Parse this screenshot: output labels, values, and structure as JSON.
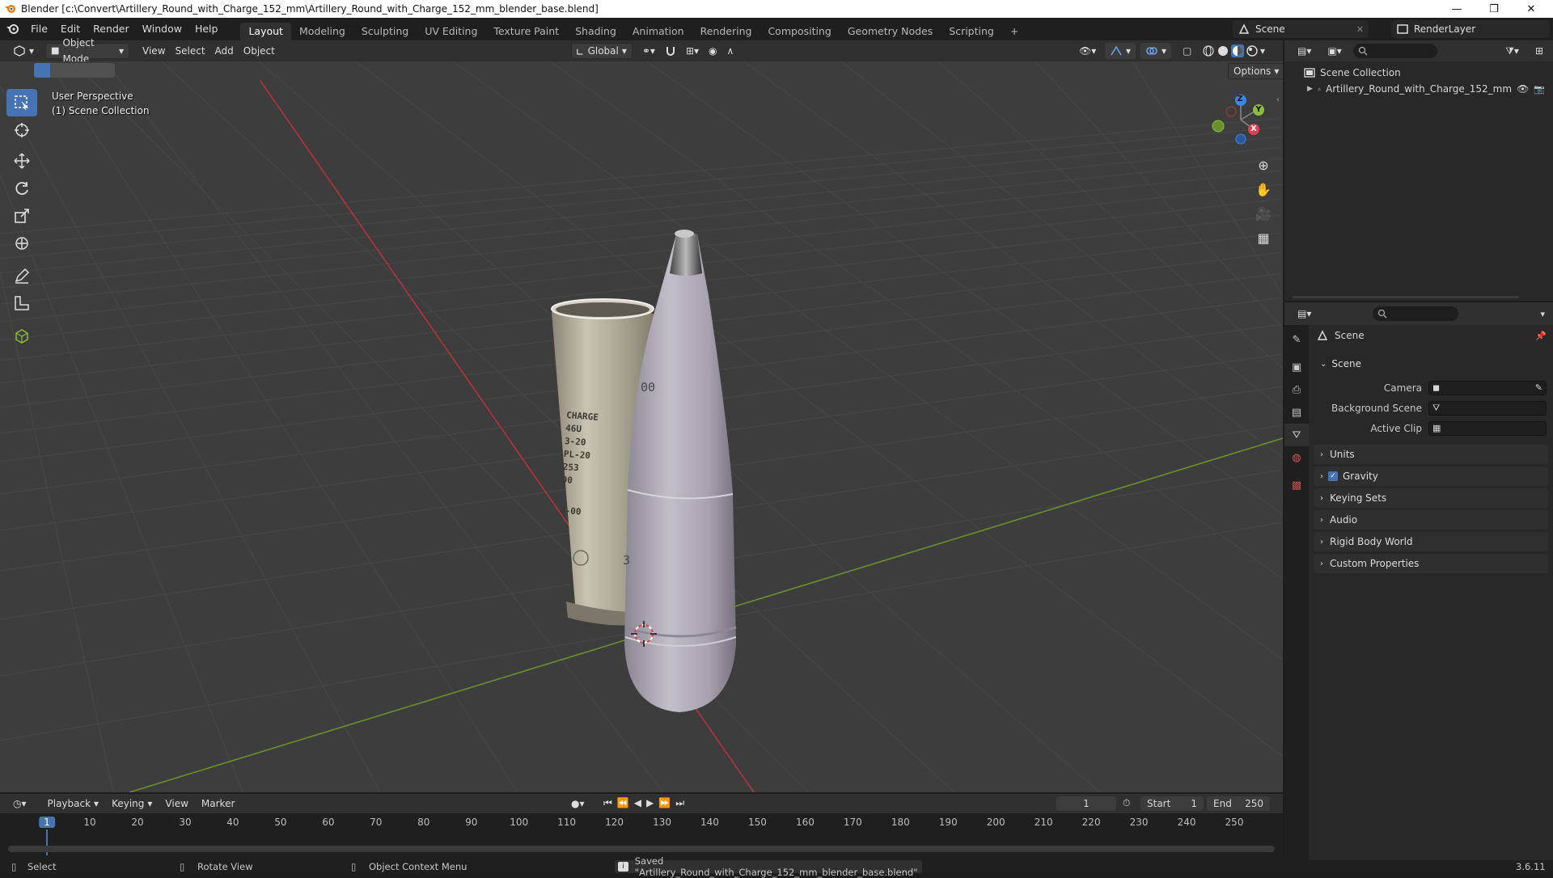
{
  "window": {
    "title": "Blender [c:\\Convert\\Artillery_Round_with_Charge_152_mm\\Artillery_Round_with_Charge_152_mm_blender_base.blend]",
    "minimize": "—",
    "maximize": "❐",
    "close": "✕"
  },
  "menu": [
    "File",
    "Edit",
    "Render",
    "Window",
    "Help"
  ],
  "workspaces": [
    "Layout",
    "Modeling",
    "Sculpting",
    "UV Editing",
    "Texture Paint",
    "Shading",
    "Animation",
    "Rendering",
    "Compositing",
    "Geometry Nodes",
    "Scripting"
  ],
  "workspace_add": "+",
  "scene_selector": {
    "scene": "Scene",
    "view_layer": "RenderLayer"
  },
  "viewport_header": {
    "mode": "Object Mode",
    "menus": [
      "View",
      "Select",
      "Add",
      "Object"
    ],
    "transform_orientation": "Global",
    "options": "Options"
  },
  "viewport": {
    "perspective": "User Perspective",
    "collection": "(1) Scene Collection",
    "axes": {
      "x": "X",
      "y": "Y",
      "z": "Z"
    },
    "casing_text": [
      "CHARGE",
      "46U",
      "3-20",
      "PL-20",
      "253",
      "00",
      "4-00"
    ],
    "shell_text": [
      "00",
      "3"
    ]
  },
  "outliner": {
    "root": "Scene Collection",
    "items": [
      {
        "label": "Artillery_Round_with_Charge_152_mm"
      }
    ]
  },
  "properties": {
    "context": "Scene",
    "panel": "Scene",
    "fields": {
      "camera": "Camera",
      "background_scene": "Background Scene",
      "active_clip": "Active Clip"
    },
    "sections": [
      "Units",
      "Gravity",
      "Keying Sets",
      "Audio",
      "Rigid Body World",
      "Custom Properties"
    ],
    "gravity_checked": true
  },
  "timeline": {
    "menus": [
      "Playback",
      "Keying",
      "View",
      "Marker"
    ],
    "current_frame": "1",
    "start_label": "Start",
    "start": "1",
    "end_label": "End",
    "end": "250",
    "ticks": [
      "1",
      "10",
      "20",
      "30",
      "40",
      "50",
      "60",
      "70",
      "80",
      "90",
      "100",
      "110",
      "120",
      "130",
      "140",
      "150",
      "160",
      "170",
      "180",
      "190",
      "200",
      "210",
      "220",
      "230",
      "240",
      "250"
    ]
  },
  "statusbar": {
    "select": "Select",
    "rotate": "Rotate View",
    "context_menu": "Object Context Menu",
    "message": "Saved \"Artillery_Round_with_Charge_152_mm_blender_base.blend\"",
    "version": "3.6.11"
  },
  "colors": {
    "accent": "#4772b3",
    "x_axis": "#e04050",
    "y_axis": "#8cbc3c",
    "z_axis": "#3d86e8"
  }
}
